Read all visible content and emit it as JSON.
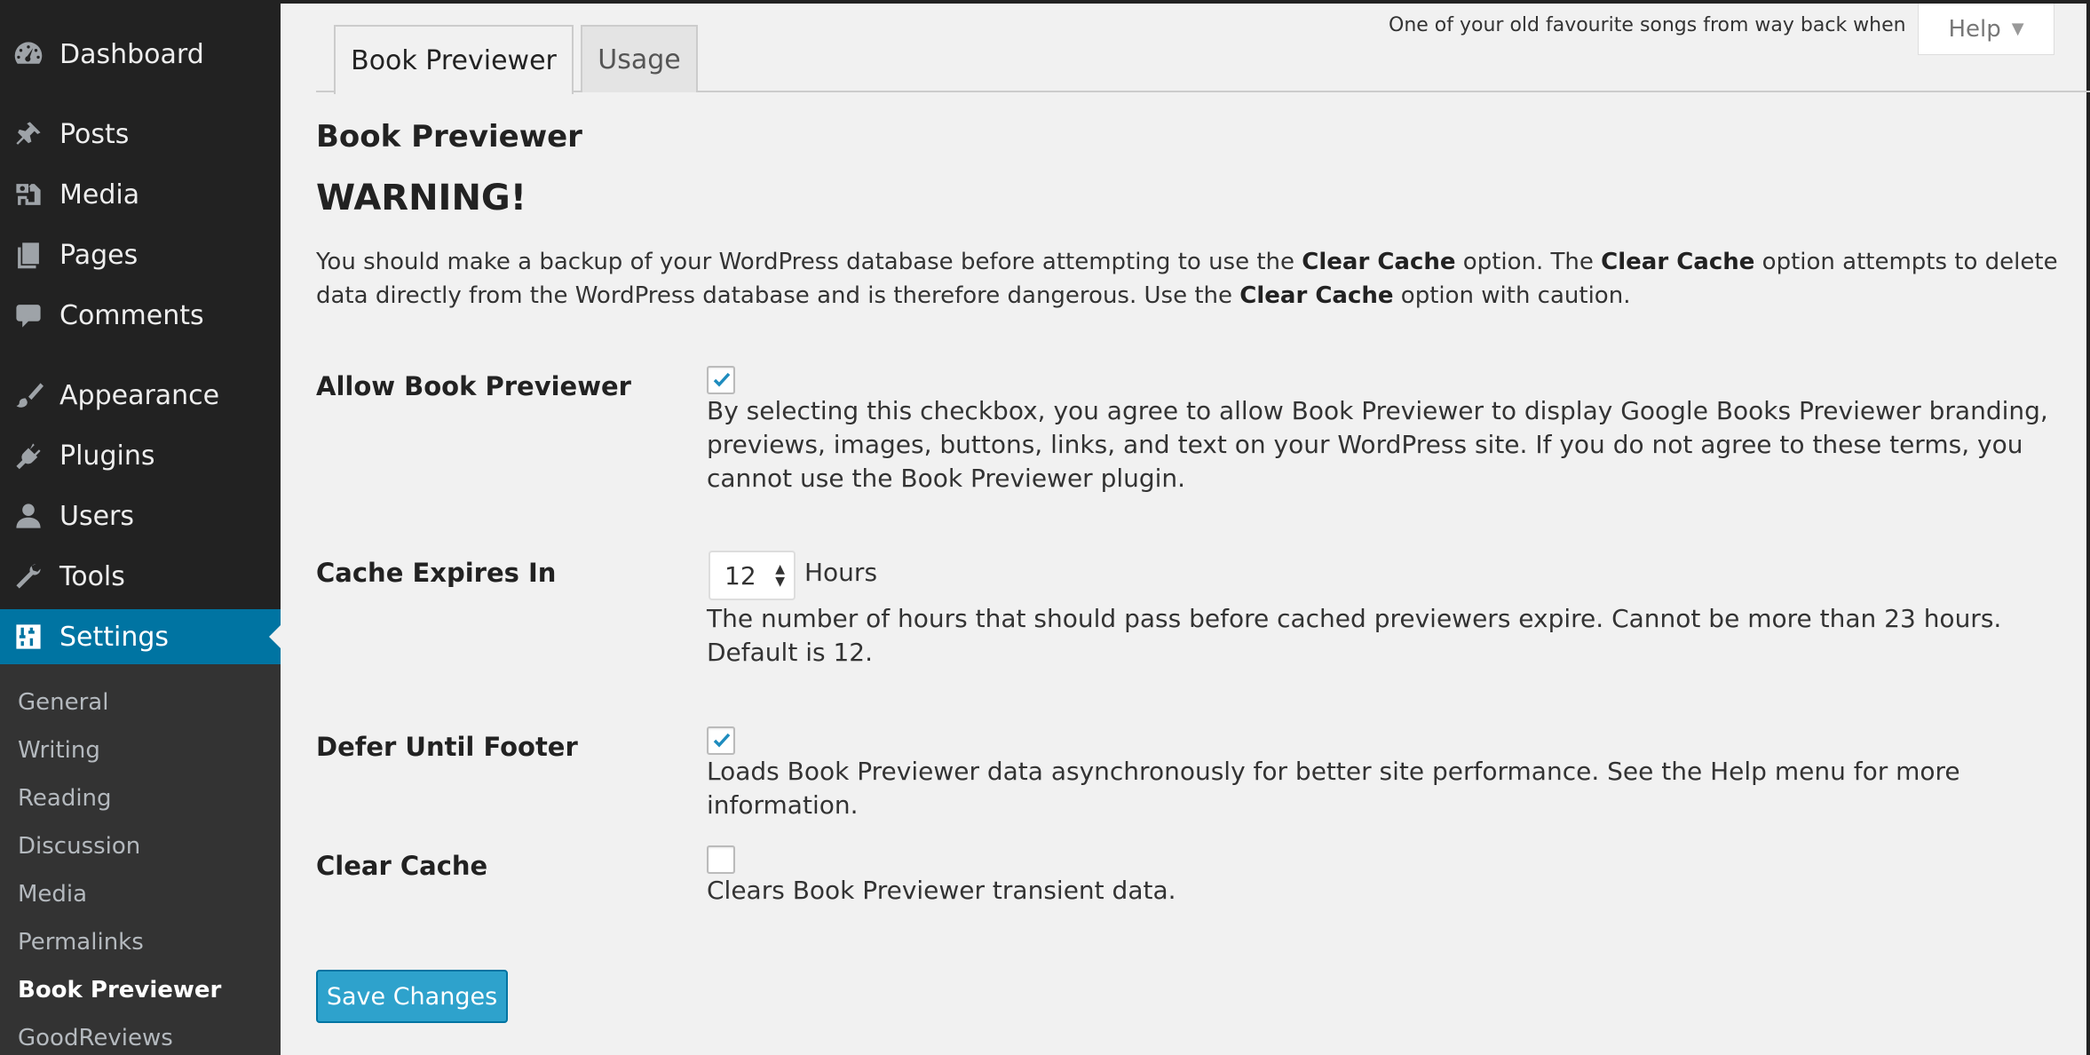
{
  "sidebar": {
    "items": [
      {
        "label": "Dashboard",
        "icon": "dashboard-icon"
      },
      {
        "label": "Posts",
        "icon": "pin-icon"
      },
      {
        "label": "Media",
        "icon": "media-icon"
      },
      {
        "label": "Pages",
        "icon": "pages-icon"
      },
      {
        "label": "Comments",
        "icon": "comment-icon"
      },
      {
        "label": "Appearance",
        "icon": "brush-icon"
      },
      {
        "label": "Plugins",
        "icon": "plug-icon"
      },
      {
        "label": "Users",
        "icon": "user-icon"
      },
      {
        "label": "Tools",
        "icon": "wrench-icon"
      },
      {
        "label": "Settings",
        "icon": "settings-icon"
      }
    ],
    "current": "Settings",
    "submenu": [
      "General",
      "Writing",
      "Reading",
      "Discussion",
      "Media",
      "Permalinks",
      "Book Previewer",
      "GoodReviews"
    ],
    "submenu_current": "Book Previewer"
  },
  "header": {
    "hello_dolly": "One of your old favourite songs from way back when",
    "help_label": "Help"
  },
  "tabs": [
    {
      "label": "Book Previewer",
      "active": true
    },
    {
      "label": "Usage",
      "active": false
    }
  ],
  "main": {
    "title": "Book Previewer",
    "warning_heading": "WARNING!",
    "warning": {
      "p1": "You should make a backup of your WordPress database before attempting to use the ",
      "b1": "Clear Cache",
      "p2": " option. The ",
      "b2": "Clear Cache",
      "p3": " option attempts to delete data directly from the WordPress database and is therefore dangerous. Use the ",
      "b3": "Clear Cache",
      "p4": " option with caution."
    },
    "allow": {
      "label": "Allow Book Previewer",
      "checked": true,
      "description": "By selecting this checkbox, you agree to allow Book Previewer to display Google Books Previewer branding, previews, images, buttons, links, and text on your WordPress site. If you do not agree to these terms, you cannot use the Book Previewer plugin."
    },
    "cache": {
      "label": "Cache Expires In",
      "value": "12",
      "unit": "Hours",
      "description": "The number of hours that should pass before cached previewers expire. Cannot be more than 23 hours. Default is 12."
    },
    "defer": {
      "label": "Defer Until Footer",
      "checked": true,
      "description": "Loads Book Previewer data asynchronously for better site performance. See the Help menu for more information."
    },
    "clear": {
      "label": "Clear Cache",
      "checked": false,
      "description": "Clears Book Previewer transient data."
    },
    "save_label": "Save Changes"
  },
  "colors": {
    "sidebar_bg": "#222222",
    "submenu_bg": "#333333",
    "accent": "#0074a2",
    "button": "#2ea2cc",
    "check": "#1e8cbe"
  }
}
